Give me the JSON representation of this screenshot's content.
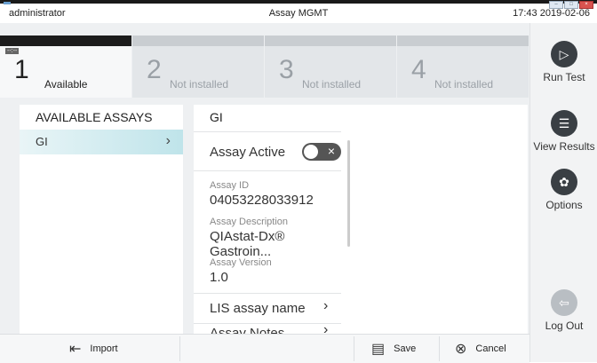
{
  "header": {
    "user": "administrator",
    "title": "Assay MGMT",
    "datetime": "17:43 2019-02-06"
  },
  "slots": [
    {
      "num": "1",
      "label": "Available",
      "tag": "--:--"
    },
    {
      "num": "2",
      "label": "Not installed"
    },
    {
      "num": "3",
      "label": "Not installed"
    },
    {
      "num": "4",
      "label": "Not installed"
    }
  ],
  "available": {
    "title": "AVAILABLE ASSAYS",
    "selected": "GI"
  },
  "detail": {
    "title": "GI",
    "active_label": "Assay Active",
    "id_label": "Assay ID",
    "id_value": "04053228033912",
    "desc_label": "Assay Description",
    "desc_value": "QIAstat-Dx® Gastroin...",
    "ver_label": "Assay Version",
    "ver_value": "1.0",
    "lis_label": "LIS assay name",
    "notes_label": "Assay Notes"
  },
  "sidebar": {
    "run": "Run Test",
    "results": "View Results",
    "options": "Options",
    "logout": "Log Out"
  },
  "footer": {
    "import": "Import",
    "save": "Save",
    "cancel": "Cancel"
  },
  "colors": {
    "accent_selected": "#bfe4ea",
    "dark": "#3a3f44"
  }
}
